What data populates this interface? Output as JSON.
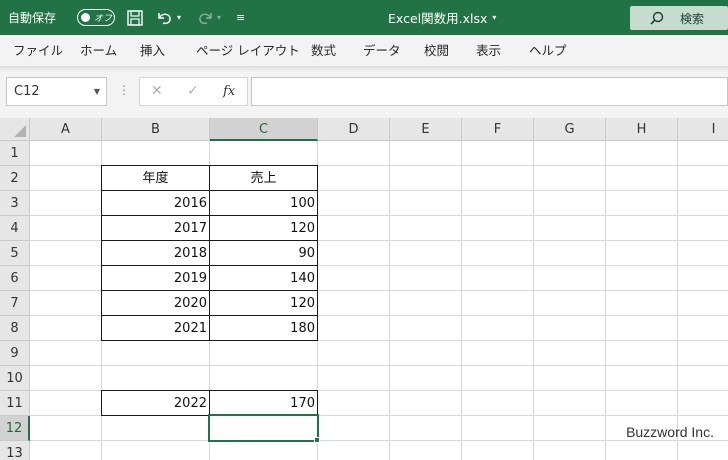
{
  "title_bar": {
    "autosave_label": "自動保存",
    "autosave_state": "オフ",
    "filename": "Excel関数用.xlsx",
    "search_label": "検索",
    "accent_color": "#217346"
  },
  "ribbon": {
    "tabs": [
      "ファイル",
      "ホーム",
      "挿入",
      "ページ レイアウト",
      "数式",
      "データ",
      "校閲",
      "表示",
      "ヘルプ"
    ]
  },
  "formula_bar": {
    "name_box": "C12",
    "fx_label": "fx",
    "formula": ""
  },
  "sheet": {
    "columns": [
      "A",
      "B",
      "C",
      "D",
      "E",
      "F",
      "G",
      "H",
      "I"
    ],
    "rows": [
      "1",
      "2",
      "3",
      "4",
      "5",
      "6",
      "7",
      "8",
      "9",
      "10",
      "11",
      "12",
      "13"
    ],
    "selected_column": "C",
    "selected_row": "12",
    "table": {
      "header": [
        "年度",
        "売上"
      ],
      "rows": [
        [
          "2016",
          "100"
        ],
        [
          "2017",
          "120"
        ],
        [
          "2018",
          "90"
        ],
        [
          "2019",
          "140"
        ],
        [
          "2020",
          "120"
        ],
        [
          "2021",
          "180"
        ]
      ]
    },
    "extra_row": [
      "2022",
      "170"
    ]
  },
  "watermark": "Buzzword Inc."
}
